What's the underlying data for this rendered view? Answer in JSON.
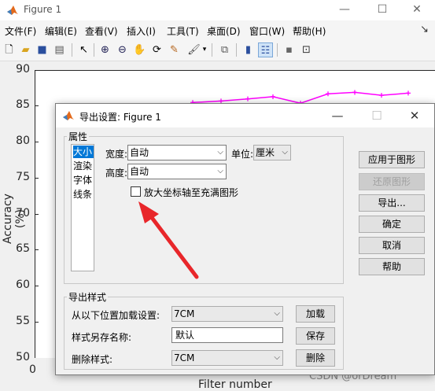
{
  "window": {
    "title": "Figure 1"
  },
  "menu": [
    "文件(F)",
    "编辑(E)",
    "查看(V)",
    "插入(I)",
    "工具(T)",
    "桌面(D)",
    "窗口(W)",
    "帮助(H)"
  ],
  "toolbar_icons": [
    "new-file-icon",
    "open-folder-icon",
    "save-icon",
    "print-icon",
    "pointer-icon",
    "zoom-in-icon",
    "zoom-out-icon",
    "pan-hand-icon",
    "rotate-3d-icon",
    "data-cursor-icon",
    "brush-icon",
    "dropdown-caret-icon",
    "link-plot-icon",
    "insert-colorbar-icon",
    "insert-legend-icon",
    "hide-plot-tools-icon",
    "show-plot-tools-icon"
  ],
  "plot": {
    "y_ticks": [
      "90",
      "85",
      "80",
      "75",
      "70",
      "65",
      "60",
      "55",
      "50"
    ],
    "x_tick": "0",
    "ylabel": "Accuracy (%)",
    "xlabel": "Filter number",
    "series_color": "#ff00ff"
  },
  "chart_data": {
    "type": "line",
    "ylim": [
      50,
      90
    ],
    "ylabel": "Accuracy (%)",
    "xlabel": "Filter number",
    "series": [
      {
        "values": [
          85.6,
          85.8,
          86.1,
          86.4,
          85.5,
          86.8,
          87.0,
          86.6,
          86.9
        ]
      }
    ]
  },
  "dialog": {
    "title": "导出设置: Figure 1",
    "properties_label": "属性",
    "properties": [
      "大小",
      "渲染",
      "字体",
      "线条"
    ],
    "selected_property": "大小",
    "width_label": "宽度:",
    "width_value": "自动",
    "height_label": "高度:",
    "height_value": "自动",
    "unit_label": "单位:",
    "unit_value": "厘米",
    "expand_checkbox_label": "放大坐标轴至充满图形",
    "expand_checked": false,
    "buttons": {
      "apply": "应用于图形",
      "restore": "还原图形",
      "export": "导出...",
      "ok": "确定",
      "cancel": "取消",
      "help": "帮助"
    },
    "export_styles": {
      "group_label": "导出样式",
      "load_label": "从以下位置加载设置:",
      "load_value": "7CM",
      "load_button": "加载",
      "save_label": "样式另存名称:",
      "save_value": "默认",
      "save_button": "保存",
      "delete_label": "删除样式:",
      "delete_value": "7CM",
      "delete_button": "删除"
    }
  },
  "annotation_color": "#e8262a",
  "watermark": "CSDN @orDream"
}
